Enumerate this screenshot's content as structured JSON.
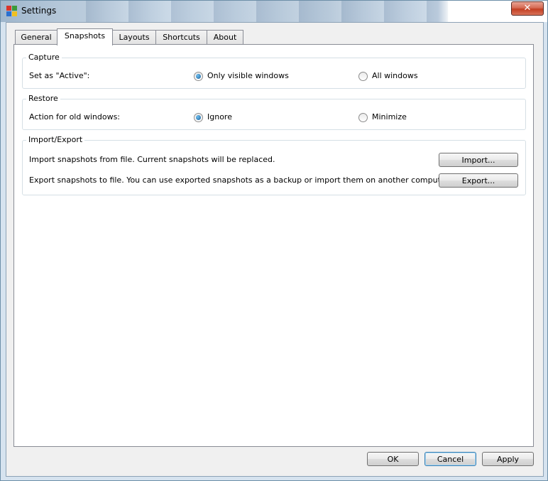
{
  "window": {
    "title": "Settings",
    "close_label": "✕"
  },
  "tabs": [
    {
      "label": "General"
    },
    {
      "label": "Snapshots"
    },
    {
      "label": "Layouts"
    },
    {
      "label": "Shortcuts"
    },
    {
      "label": "About"
    }
  ],
  "active_tab": "Snapshots",
  "capture": {
    "title": "Capture",
    "label": "Set as \"Active\":",
    "options": [
      {
        "label": "Only visible windows",
        "selected": true
      },
      {
        "label": "All windows",
        "selected": false
      }
    ]
  },
  "restore": {
    "title": "Restore",
    "label": "Action for old windows:",
    "options": [
      {
        "label": "Ignore",
        "selected": true
      },
      {
        "label": "Minimize",
        "selected": false
      }
    ]
  },
  "import_export": {
    "title": "Import/Export",
    "import_text": "Import snapshots from file. Current snapshots will be replaced.",
    "import_button": "Import...",
    "export_text": "Export snapshots to file. You can use exported snapshots as a backup or import them on another computer.",
    "export_button": "Export..."
  },
  "footer": {
    "ok": "OK",
    "cancel": "Cancel",
    "apply": "Apply"
  },
  "colors": {
    "accent": "#3c7fb1",
    "close": "#c33f22"
  }
}
